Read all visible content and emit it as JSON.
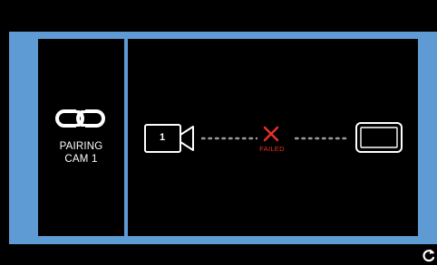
{
  "pairing": {
    "line1": "PAIRING",
    "line2": "CAM 1",
    "icon": "link-icon"
  },
  "camera": {
    "number": "1",
    "icon": "camera-icon"
  },
  "status": {
    "label": "FAILED",
    "icon": "close-icon",
    "color": "#E8302A"
  },
  "monitor": {
    "icon": "monitor-icon"
  },
  "footer": {
    "icon": "refresh-icon"
  },
  "colors": {
    "frame": "#5E9BD5",
    "background": "#000000",
    "foreground": "#FFFFFF",
    "error": "#E8302A"
  }
}
